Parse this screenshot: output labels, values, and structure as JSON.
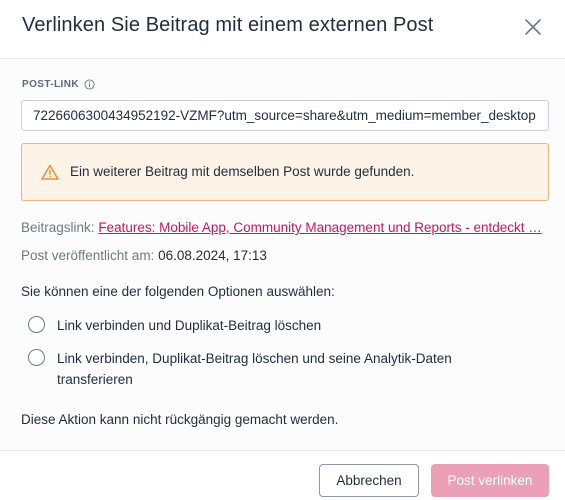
{
  "dialog": {
    "title": "Verlinken Sie Beitrag mit einem externen Post",
    "close_icon": "close-icon"
  },
  "post_link": {
    "label": "POST-LINK",
    "info_icon": "info-icon",
    "value": "7226606300434952192-VZMF?utm_source=share&utm_medium=member_desktop"
  },
  "warning": {
    "icon": "warning-icon",
    "text": "Ein weiterer Beitrag mit demselben Post wurde gefunden.",
    "colors": {
      "background": "#fdf3e7",
      "border": "#f0b47a",
      "icon": "#e8913a"
    }
  },
  "details": {
    "link_label": "Beitragslink:",
    "link_text": "Features: Mobile App, Community Management und Reports - entdeckt …",
    "published_label": "Post veröffentlicht am:",
    "published_value": "06.08.2024, 17:13"
  },
  "options": {
    "intro": "Sie können eine der folgenden Optionen auswählen:",
    "items": [
      {
        "label": "Link verbinden und Duplikat-Beitrag löschen",
        "selected": false
      },
      {
        "label": "Link verbinden, Duplikat-Beitrag löschen und seine Analytik-Daten transferieren",
        "selected": false
      }
    ]
  },
  "notice": "Diese Aktion kann nicht rückgängig gemacht werden.",
  "footer": {
    "cancel_label": "Abbrechen",
    "confirm_label": "Post verlinken",
    "confirm_color": "#eba0b7",
    "link_color": "#c4185b"
  }
}
